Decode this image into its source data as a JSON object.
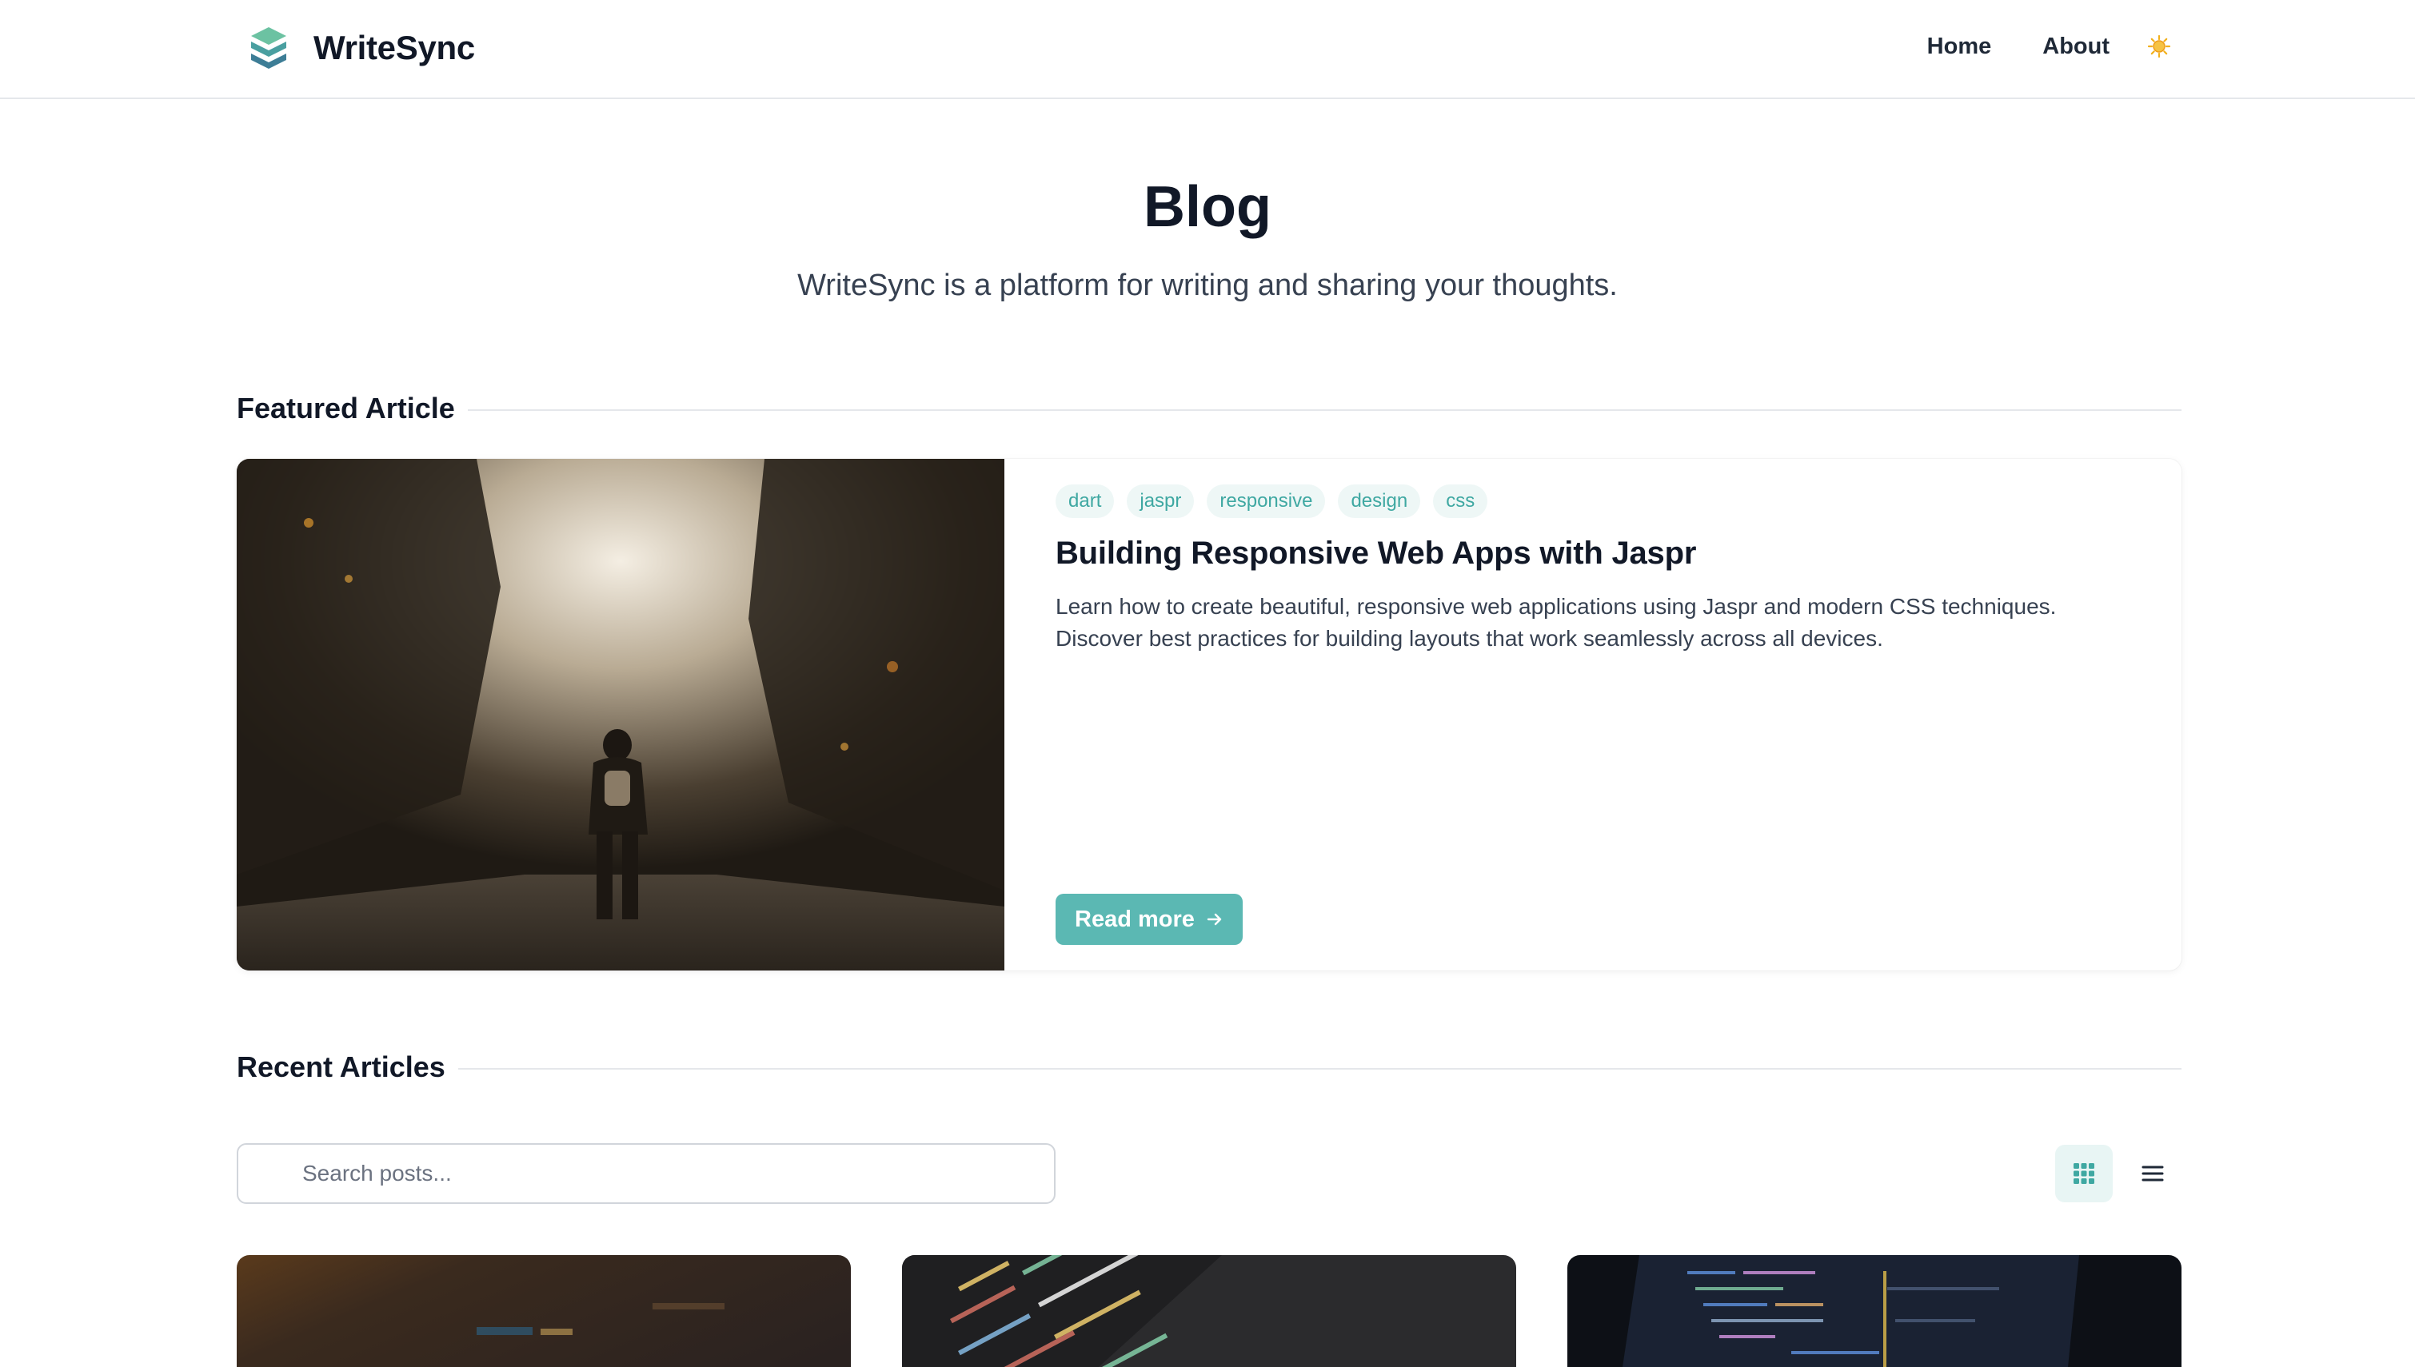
{
  "header": {
    "brand": "WriteSync",
    "nav": [
      {
        "label": "Home"
      },
      {
        "label": "About"
      }
    ],
    "theme_toggle_icon": "sun-icon"
  },
  "hero": {
    "title": "Blog",
    "subtitle": "WriteSync is a platform for writing and sharing your thoughts."
  },
  "featured": {
    "section_title": "Featured Article",
    "tags": [
      "dart",
      "jaspr",
      "responsive",
      "design",
      "css"
    ],
    "title": "Building Responsive Web Apps with Jaspr",
    "excerpt": "Learn how to create beautiful, responsive web applications using Jaspr and modern CSS techniques. Discover best practices for building layouts that work seamlessly across all devices.",
    "cta_label": "Read more",
    "cta_icon": "arrow-right-icon"
  },
  "recent": {
    "section_title": "Recent Articles",
    "search_placeholder": "Search posts...",
    "search_value": "",
    "view_modes": [
      {
        "icon": "grid-view-icon",
        "active": true
      },
      {
        "icon": "list-view-icon",
        "active": false
      }
    ]
  },
  "colors": {
    "accent": "#5bb8b3",
    "tag_bg": "#eef7f6",
    "tag_text": "#3fa8a2",
    "text": "#111827",
    "muted": "#374151"
  }
}
